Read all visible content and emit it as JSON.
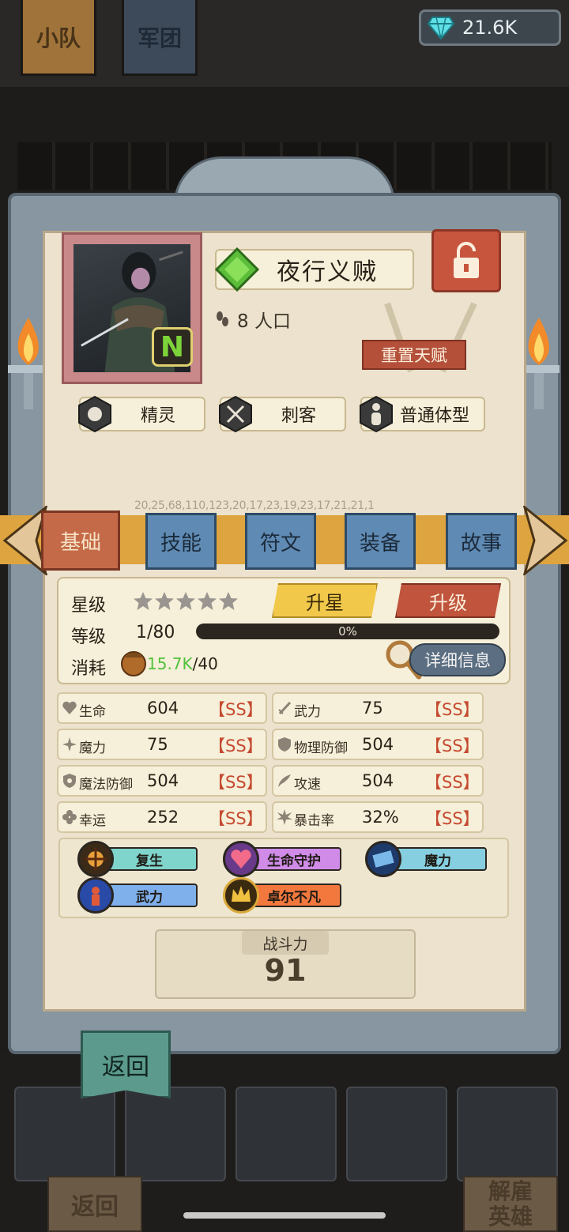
{
  "top_tabs": {
    "squad": "小队",
    "legion": "军团"
  },
  "currency": {
    "diamonds": "21.6K",
    "icon": "diamond-icon"
  },
  "hero": {
    "name": "夜行义贼",
    "rarity": "N",
    "population": "8 人口",
    "reset_talent": "重置天赋",
    "tags": [
      "精灵",
      "刺客",
      "普通体型"
    ]
  },
  "debug_text": "20,25,68,110,123,20,17,23,19,23,17,21,21,1",
  "tabs": [
    "基础",
    "技能",
    "符文",
    "装备",
    "故事"
  ],
  "basic": {
    "star_label": "星级",
    "level_label": "等级",
    "level_value": "1/80",
    "progress_text": "0%",
    "progress": 0,
    "cost_label": "消耗",
    "cost_have": "15.7K",
    "cost_need": "/40",
    "star_up_button": "升星",
    "level_up_button": "升级",
    "detail_button": "详细信息",
    "stars_filled": 0,
    "stars_total": 5
  },
  "stats": [
    {
      "name": "生命",
      "value": "604",
      "grade": "【SS】"
    },
    {
      "name": "武力",
      "value": "75",
      "grade": "【SS】"
    },
    {
      "name": "魔力",
      "value": "75",
      "grade": "【SS】"
    },
    {
      "name": "物理防御",
      "value": "504",
      "grade": "【SS】"
    },
    {
      "name": "魔法防御",
      "value": "504",
      "grade": "【SS】"
    },
    {
      "name": "攻速",
      "value": "504",
      "grade": "【SS】"
    },
    {
      "name": "幸运",
      "value": "252",
      "grade": "【SS】"
    },
    {
      "name": "暴击率",
      "value": "32%",
      "grade": "【SS】"
    }
  ],
  "talents": [
    {
      "name": "复生",
      "color": "#7fd4cc"
    },
    {
      "name": "生命守护",
      "color": "#d08be8"
    },
    {
      "name": "魔力",
      "color": "#86cfe0"
    },
    {
      "name": "武力",
      "color": "#7fb0ec"
    },
    {
      "name": "卓尔不凡",
      "color": "#f2783e"
    }
  ],
  "power": {
    "label": "战斗力",
    "value": "91"
  },
  "back_button": "返回",
  "bottom": {
    "back": "返回",
    "dismiss_line1": "解雇",
    "dismiss_line2": "英雄"
  }
}
